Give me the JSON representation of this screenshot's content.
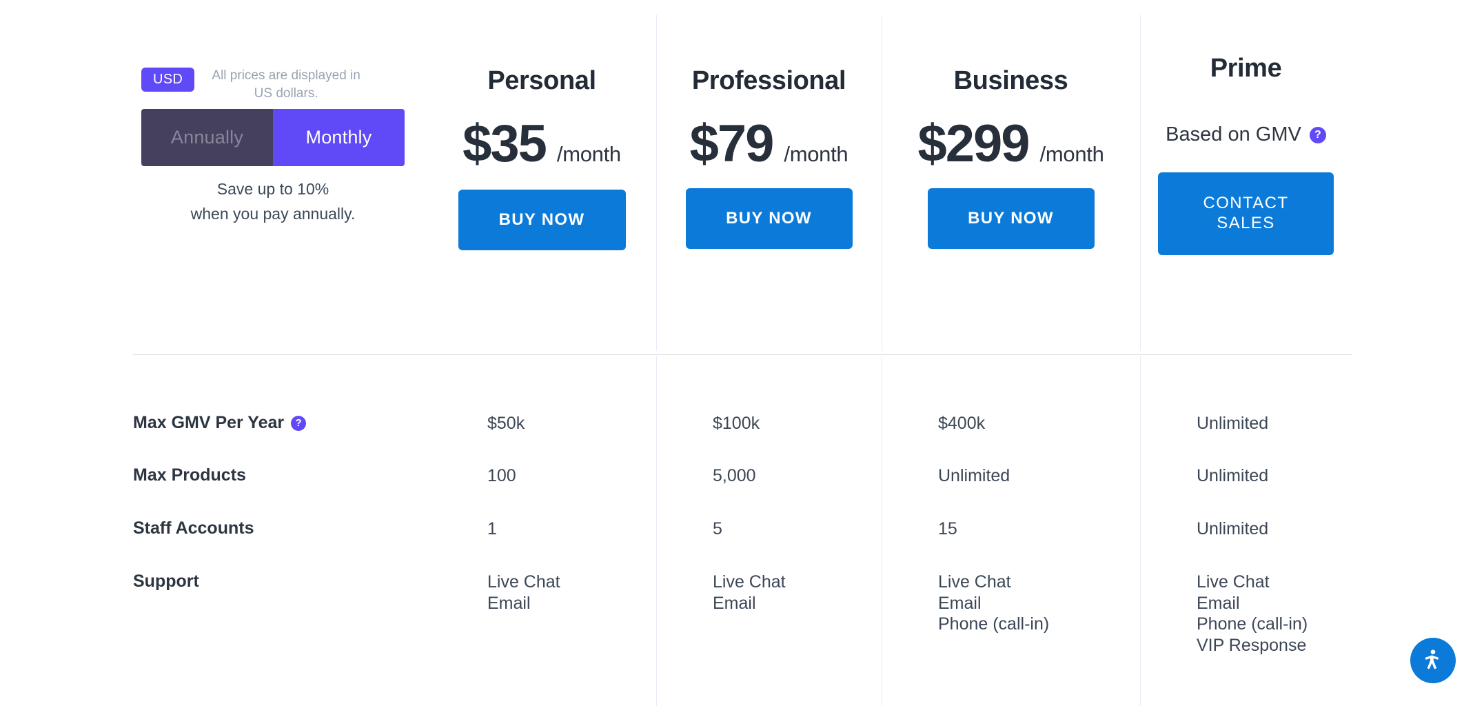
{
  "currency": {
    "badge_label": "USD",
    "note": "All prices are displayed in US dollars.",
    "accent_color": "#6049f7"
  },
  "billing_toggle": {
    "options": [
      {
        "label": "Annually",
        "selected": false
      },
      {
        "label": "Monthly",
        "selected": true
      }
    ],
    "annually_label": "Annually",
    "monthly_label": "Monthly",
    "save_note_line1": "Save up to 10%",
    "save_note_line2": "when you pay annually.",
    "inactive_bg": "#45405e",
    "active_bg": "#6049f7"
  },
  "plans": [
    {
      "name": "Personal",
      "price": "$35",
      "period": "/month",
      "cta_label": "BUY NOW",
      "cta_color": "#0b7ad8"
    },
    {
      "name": "Professional",
      "price": "$79",
      "period": "/month",
      "cta_label": "BUY NOW",
      "cta_color": "#0b7ad8"
    },
    {
      "name": "Business",
      "price": "$299",
      "period": "/month",
      "cta_label": "BUY NOW",
      "cta_color": "#0b7ad8"
    },
    {
      "name": "Prime",
      "price_note": "Based on GMV",
      "help_icon": "question-mark-icon",
      "cta_label_line1": "CONTACT",
      "cta_label_line2": "SALES",
      "cta_color": "#0b7ad8"
    }
  ],
  "features": [
    {
      "label": "Max GMV Per Year",
      "has_help_icon": true,
      "values": [
        "$50k",
        "$100k",
        "$400k",
        "Unlimited"
      ]
    },
    {
      "label": "Max Products",
      "has_help_icon": false,
      "values": [
        "100",
        "5,000",
        "Unlimited",
        "Unlimited"
      ]
    },
    {
      "label": "Staff Accounts",
      "has_help_icon": false,
      "values": [
        "1",
        "5",
        "15",
        "Unlimited"
      ]
    },
    {
      "label": "Support",
      "has_help_icon": false,
      "values_multiline": [
        [
          "Live Chat",
          "Email"
        ],
        [
          "Live Chat",
          "Email"
        ],
        [
          "Live Chat",
          "Email",
          "Phone (call-in)"
        ],
        [
          "Live Chat",
          "Email",
          "Phone (call-in)",
          "VIP Response"
        ]
      ]
    }
  ],
  "support_values": {
    "personal": "Live Chat\nEmail",
    "professional": "Live Chat\nEmail",
    "business": "Live Chat\nEmail\nPhone (call-in)",
    "prime": "Live Chat\nEmail\nPhone (call-in)\nVIP Response"
  },
  "accessibility_widget": {
    "icon": "accessibility-person-icon",
    "color": "#0b7ad8"
  },
  "help_icon_glyph": "?"
}
